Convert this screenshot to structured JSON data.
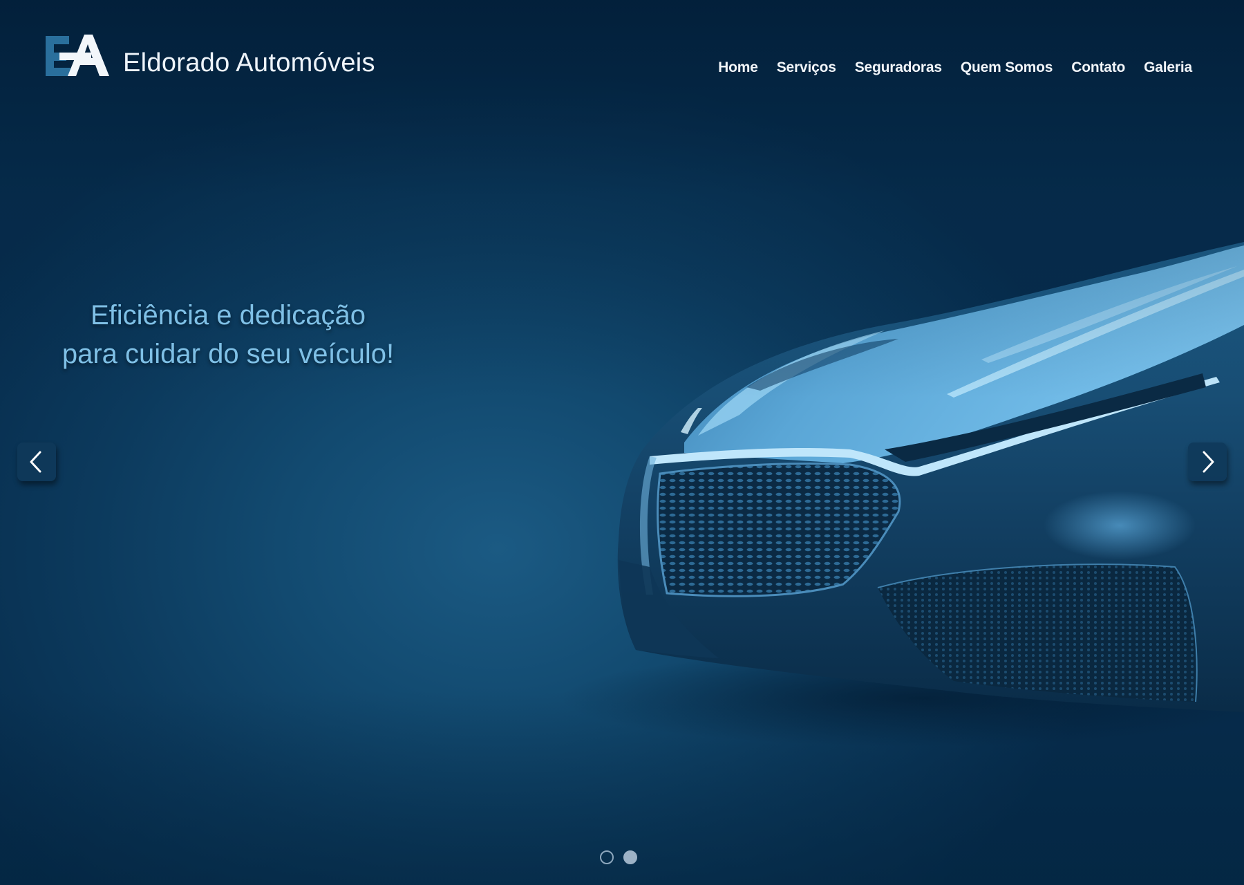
{
  "header": {
    "logo_text": "EA",
    "brand_name": "Eldorado Automóveis"
  },
  "nav": {
    "items": [
      {
        "label": "Home"
      },
      {
        "label": "Serviços"
      },
      {
        "label": "Seguradoras"
      },
      {
        "label": "Quem Somos"
      },
      {
        "label": "Contato"
      },
      {
        "label": "Galeria"
      }
    ]
  },
  "hero": {
    "tagline_line1": "Eficiência e dedicação",
    "tagline_line2": "para cuidar do seu veículo!",
    "prev_icon": "chevron-left-icon",
    "next_icon": "chevron-right-icon"
  },
  "carousel": {
    "slide_count": 2,
    "active_index": 1
  },
  "colors": {
    "background": "#0c3a5d",
    "tagline": "#7fc0e6",
    "nav_text": "#f1f5f9",
    "brand_text": "#eef4fa"
  }
}
